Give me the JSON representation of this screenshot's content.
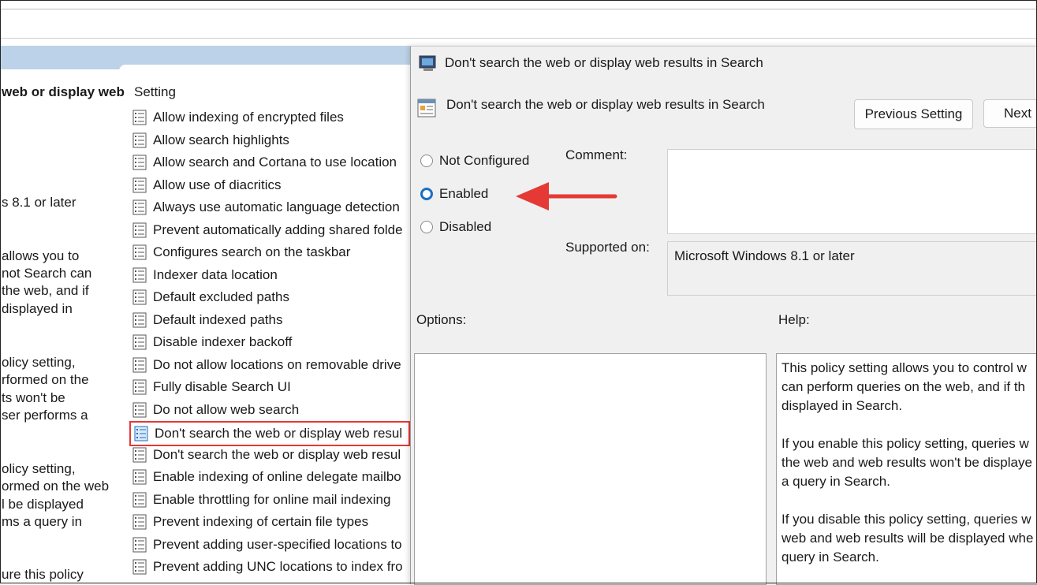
{
  "left_panel": {
    "title": "web or display web",
    "lines": [
      "s 8.1 or later",
      "allows you to",
      "not Search can",
      " the web, and if",
      "displayed in",
      "olicy setting,",
      "rformed on the",
      "ts won't be",
      "ser performs a",
      "olicy setting,",
      "ormed on the web",
      "l be displayed",
      "ms a query in",
      "ure this policy"
    ]
  },
  "settings_list": {
    "header": "Setting",
    "items": [
      "Allow indexing of encrypted files",
      "Allow search highlights",
      "Allow search and Cortana to use location",
      "Allow use of diacritics",
      "Always use automatic language detection",
      "Prevent automatically adding shared folde",
      "Configures search on the taskbar",
      "Indexer data location",
      "Default excluded paths",
      "Default indexed paths",
      "Disable indexer backoff",
      "Do not allow locations on removable drive",
      "Fully disable Search UI",
      "Do not allow web search",
      "Don't search the web or display web resul",
      "Don't search the web or display web resul",
      "Enable indexing of online delegate mailbo",
      "Enable throttling for online mail indexing",
      "Prevent indexing of certain file types",
      "Prevent adding user-specified locations to",
      "Prevent adding UNC locations to index fro"
    ],
    "selected_index": 14
  },
  "dialog": {
    "title": "Don't search the web or display web results in Search",
    "subtitle": "Don't search the web or display web results in Search",
    "previous_button": "Previous Setting",
    "next_button": "Next",
    "radio_not_configured": "Not Configured",
    "radio_enabled": "Enabled",
    "radio_disabled": "Disabled",
    "selected_radio": "Enabled",
    "comment_label": "Comment:",
    "comment_value": "",
    "supported_label": "Supported on:",
    "supported_value": "Microsoft Windows 8.1 or later",
    "options_label": "Options:",
    "help_label": "Help:",
    "help_paragraphs": [
      "This policy setting allows you to control w\ncan perform queries on the web, and if th\ndisplayed in Search.",
      "If you enable this policy setting, queries w\nthe web and web results won't be displaye\na query in Search.",
      "If you disable this policy setting, queries w\nweb and web results will be displayed whe\nquery in Search."
    ]
  },
  "annotation": {
    "arrow_color": "#e53935",
    "highlight_color": "#e53935"
  },
  "icons": {
    "setting_item": "policy-setting-icon",
    "dialog_window": "group-policy-window-icon",
    "dialog_sub": "policy-document-icon"
  }
}
